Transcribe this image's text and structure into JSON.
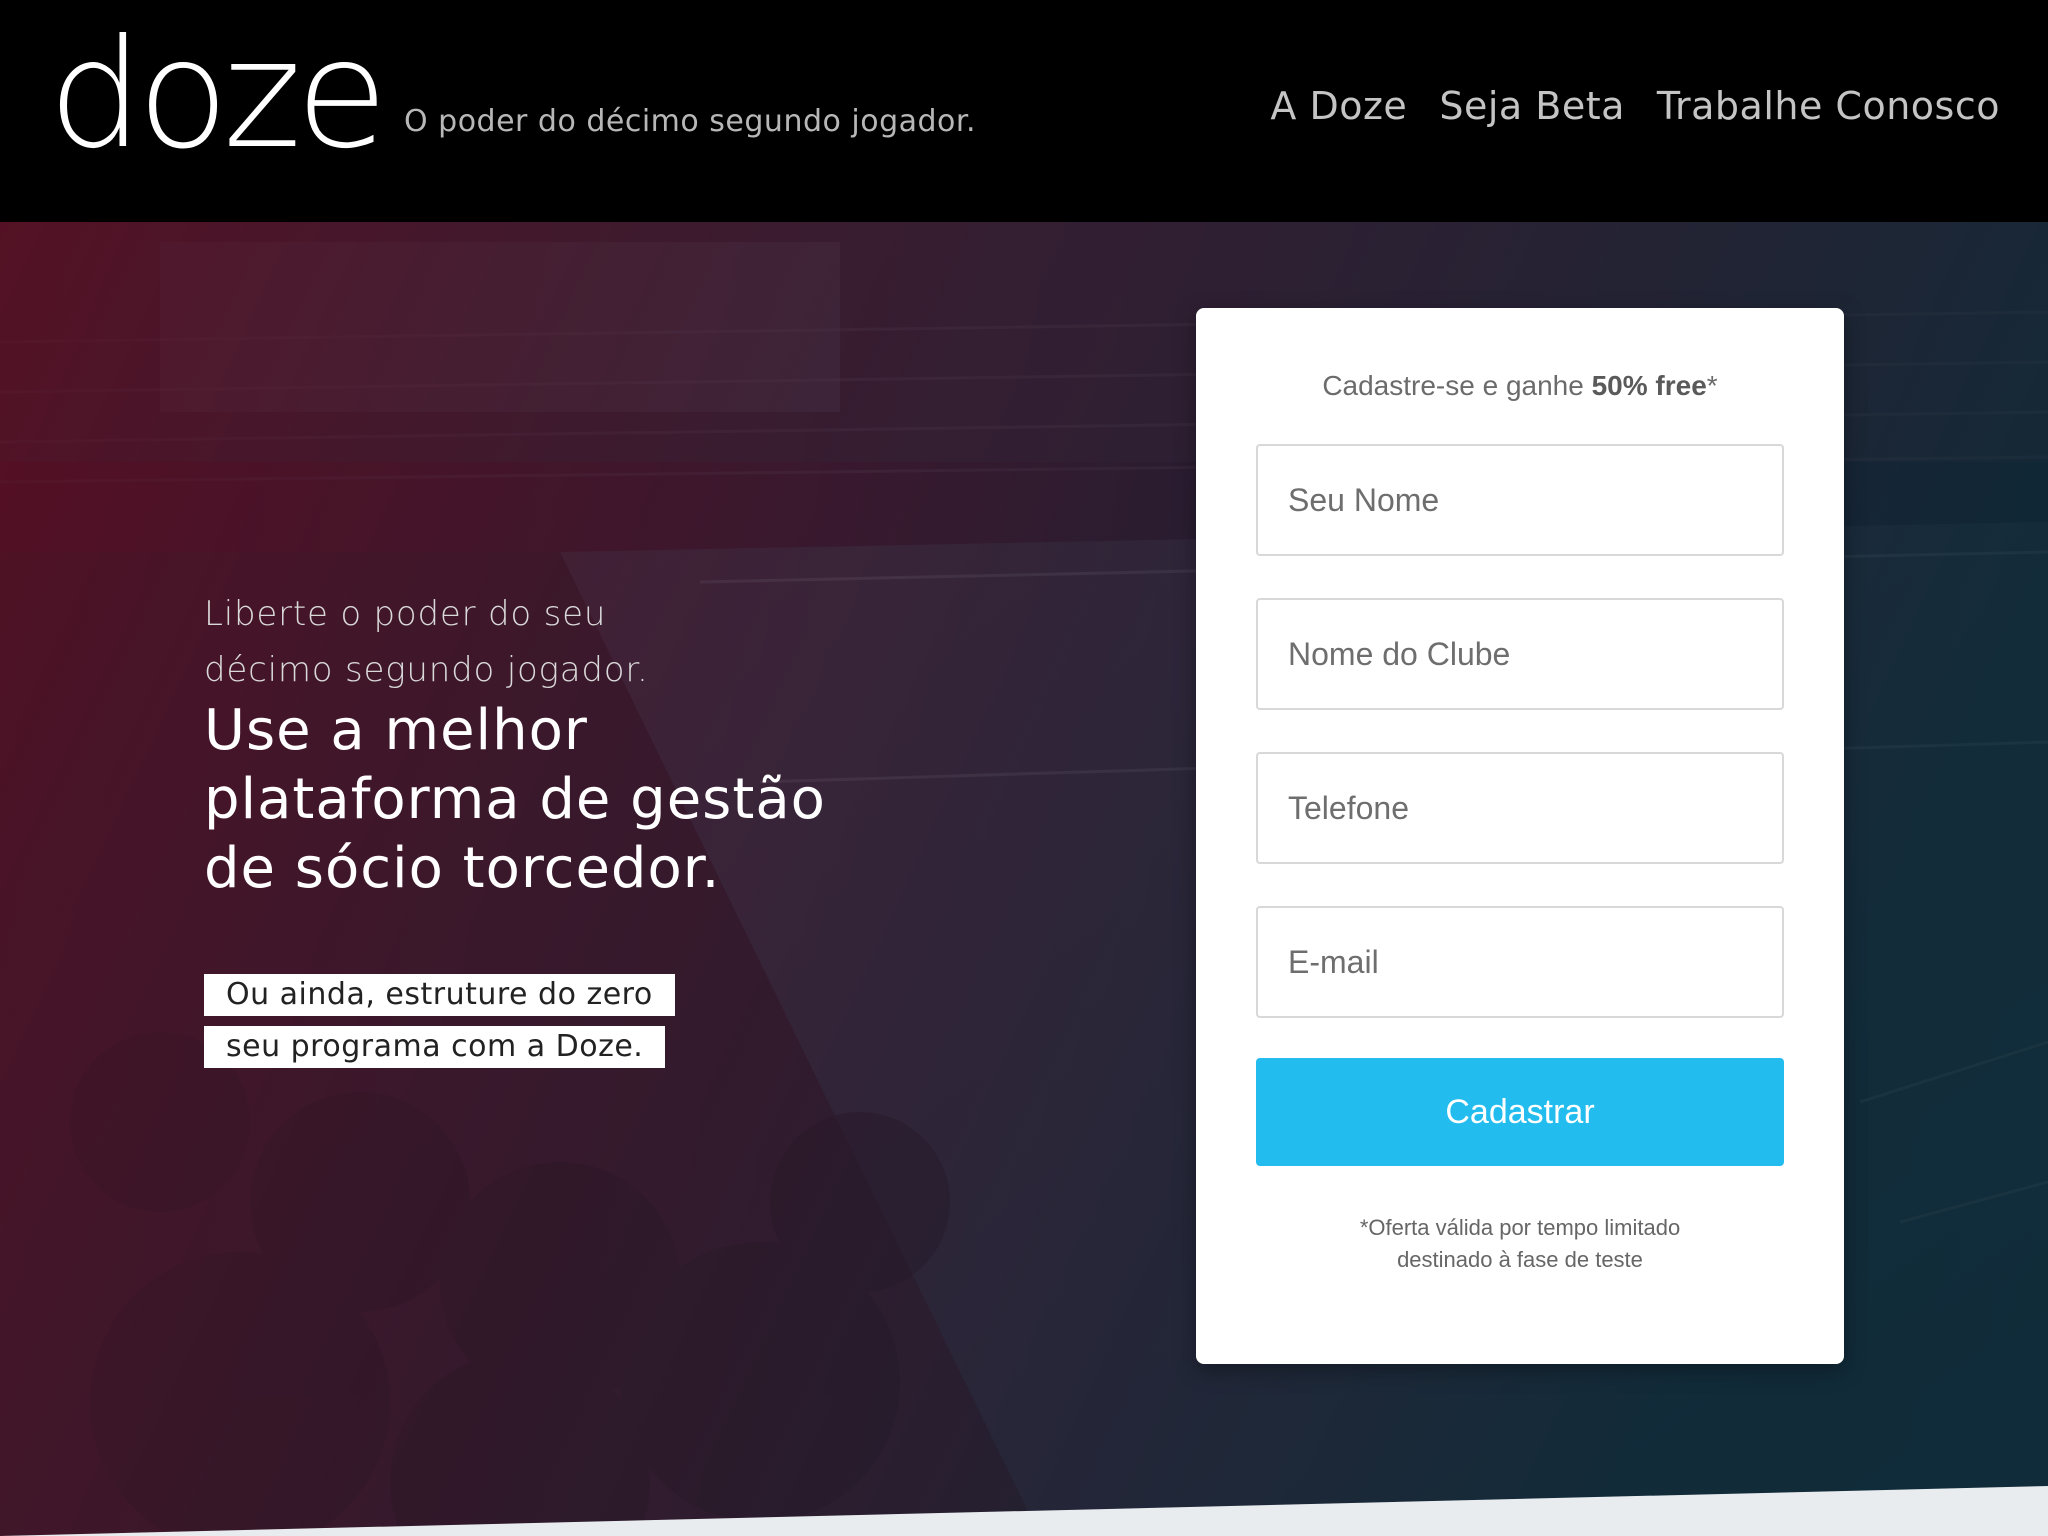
{
  "header": {
    "logo_text": "doze",
    "tagline": "O poder do décimo segundo jogador.",
    "nav": [
      {
        "label": "A Doze"
      },
      {
        "label": "Seja Beta"
      },
      {
        "label": "Trabalhe Conosco"
      }
    ]
  },
  "hero": {
    "intro_line_1": "Liberte o poder do seu",
    "intro_line_2": "décimo segundo jogador.",
    "headline_line_1": "Use a melhor",
    "headline_line_2": "plataforma de gestão",
    "headline_line_3": "de sócio torcedor.",
    "cta_line_1": "Ou ainda, estruture do zero",
    "cta_line_2": "seu programa com a Doze."
  },
  "form": {
    "promo_prefix": "Cadastre-se e ganhe ",
    "promo_bold": "50% free",
    "promo_suffix": "*",
    "fields": [
      {
        "placeholder": "Seu Nome"
      },
      {
        "placeholder": "Nome do Clube"
      },
      {
        "placeholder": "Telefone"
      },
      {
        "placeholder": "E-mail"
      }
    ],
    "submit_label": "Cadastrar",
    "disclaimer_line_1": "*Oferta válida por tempo limitado",
    "disclaimer_line_2": "destinado à fase de teste"
  },
  "colors": {
    "accent": "#22bdee",
    "header_bg": "#000000",
    "hero_tint_left": "#4a0c1c",
    "hero_tint_right": "#0c222e"
  }
}
